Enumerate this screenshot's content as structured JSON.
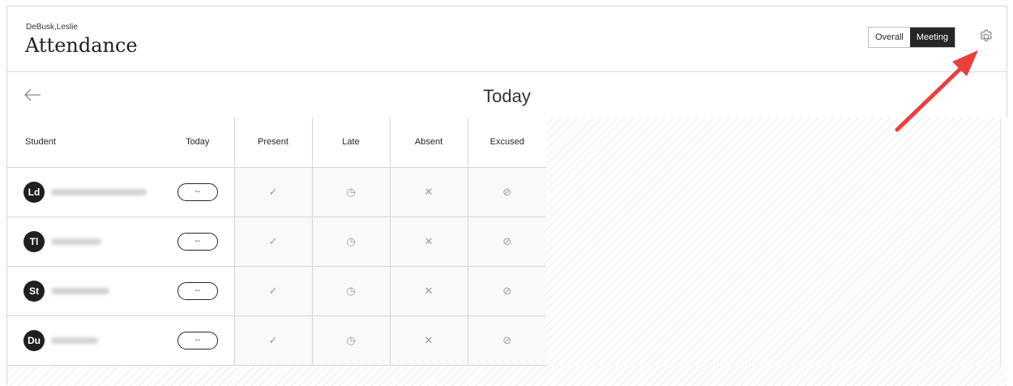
{
  "header": {
    "course_name": "DeBusk,Leslie",
    "title": "Attendance",
    "view_toggle": [
      {
        "label": "Overall",
        "active": false
      },
      {
        "label": "Meeting",
        "active": true
      }
    ],
    "settings_icon": "gear-icon"
  },
  "subheader": {
    "back_icon": "arrow-left-icon",
    "date_title": "Today"
  },
  "table": {
    "columns": [
      "Student",
      "Today",
      "Present",
      "Late",
      "Absent",
      "Excused"
    ],
    "rows": [
      {
        "initials": "Ld",
        "status": "--"
      },
      {
        "initials": "Tl",
        "status": "--"
      },
      {
        "initials": "St",
        "status": "--"
      },
      {
        "initials": "Du",
        "status": "--"
      }
    ],
    "icons": {
      "present": "✓",
      "late": "◷",
      "absent": "✕",
      "excused": "⊘"
    }
  },
  "colors": {
    "accent_dark": "#262626",
    "annotation_arrow": "#e8403a"
  }
}
